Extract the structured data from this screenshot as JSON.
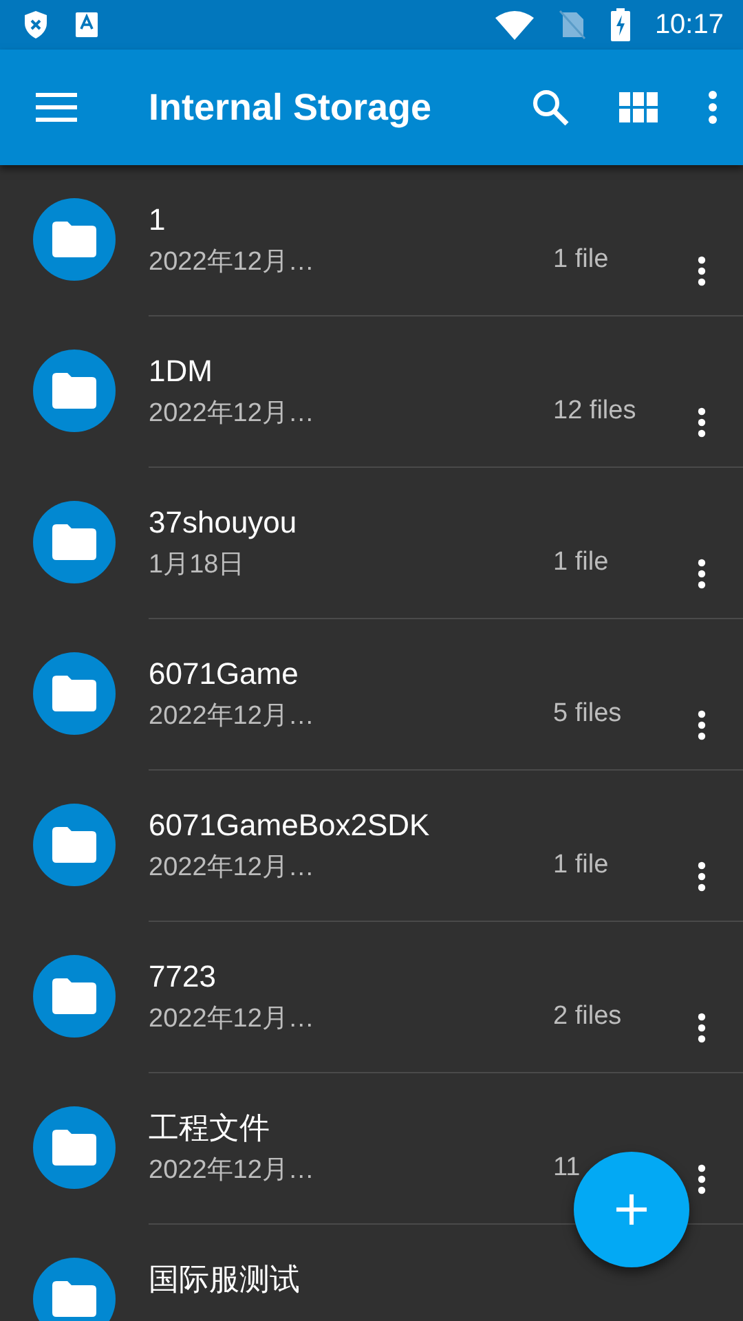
{
  "status_bar": {
    "time": "10:17"
  },
  "app_bar": {
    "title": "Internal Storage"
  },
  "folders": [
    {
      "name": "1",
      "date": "2022年12月…",
      "count": "1 file"
    },
    {
      "name": "1DM",
      "date": "2022年12月…",
      "count": "12 files"
    },
    {
      "name": "37shouyou",
      "date": "1月18日",
      "count": "1 file"
    },
    {
      "name": "6071Game",
      "date": "2022年12月…",
      "count": "5 files"
    },
    {
      "name": "6071GameBox2SDK",
      "date": "2022年12月…",
      "count": "1 file"
    },
    {
      "name": "7723",
      "date": "2022年12月…",
      "count": "2 files"
    },
    {
      "name": "工程文件",
      "date": "2022年12月…",
      "count": "11"
    },
    {
      "name": "国际服测试"
    }
  ]
}
